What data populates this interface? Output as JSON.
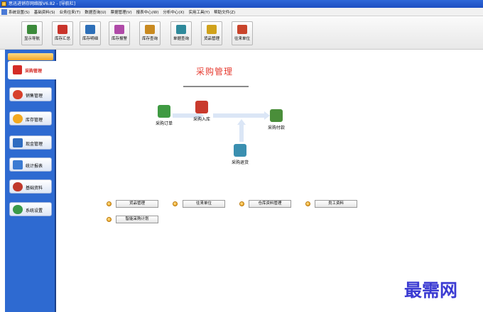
{
  "window": {
    "title": "思迅进销存网络版V6.82 - [导航栏]"
  },
  "menu": [
    "系统设置(S)",
    "基础资料(S)",
    "业务往来(T)",
    "数据查询(U)",
    "票据管理(V)",
    "报表中心(W)",
    "分析中心(X)",
    "实用工具(Y)",
    "帮助文件(Z)"
  ],
  "toolbar": [
    {
      "label": "显示导航",
      "color": "#3b8a3a"
    },
    {
      "label": "库存汇总",
      "color": "#c9342b"
    },
    {
      "label": "库存明细",
      "color": "#2d6fb8"
    },
    {
      "label": "库存报警",
      "color": "#b04aa8"
    },
    {
      "label": "库存查询",
      "color": "#c98a20"
    },
    {
      "label": "单据查询",
      "color": "#2f8a9b"
    },
    {
      "label": "货品管理",
      "color": "#d0a21b"
    },
    {
      "label": "往来单位",
      "color": "#c9442b"
    }
  ],
  "sidebar": {
    "active": {
      "label": "采购管理"
    },
    "items": [
      {
        "label": "销售管理",
        "color": "#d7402c"
      },
      {
        "label": "库存管理",
        "color": "#f3a91f"
      },
      {
        "label": "现金管理",
        "color": "#2f6cc0"
      },
      {
        "label": "统计报表",
        "color": "#3c7bd2"
      },
      {
        "label": "基础资料",
        "color": "#c0392b"
      },
      {
        "label": "系统设置",
        "color": "#3a9a4a"
      }
    ]
  },
  "main": {
    "title": "采购管理",
    "flow": {
      "order": "采购订单",
      "receive": "采购入库",
      "pay": "采购付款",
      "return": "采购退货"
    },
    "quick_buttons": [
      "货品管理",
      "往来单位",
      "仓库资料管理",
      "员工资料",
      "智能采购计划"
    ]
  },
  "watermark": "最需网",
  "colors": {
    "accent": "#e63a2f",
    "sidebar": "#2e6ad1"
  }
}
